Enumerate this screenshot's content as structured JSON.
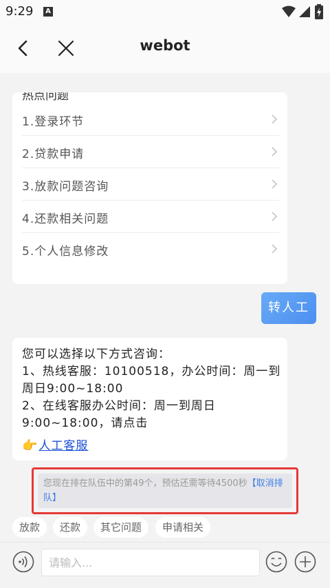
{
  "status": {
    "time": "9:29",
    "notification_letter": "A"
  },
  "header": {
    "title": "webot"
  },
  "hot_questions": {
    "title": "热点问题",
    "items": [
      {
        "label": "1.登录环节"
      },
      {
        "label": "2.贷款申请"
      },
      {
        "label": "3.放款问题咨询"
      },
      {
        "label": "4.还款相关问题"
      },
      {
        "label": "5.个人信息修改"
      }
    ]
  },
  "user_message": {
    "text": "转人工"
  },
  "bot_message": {
    "line1": "您可以选择以下方式咨询：",
    "line2": "1、热线客服：10100518，办公时间：周一到周日9:00~18:00",
    "line3": "2、在线客服办公时间：周一到周日9:00~18:00，请点击",
    "link_text": "人工客服"
  },
  "queue": {
    "text": "您现在排在队伍中的第49个，预估还需等待4500秒",
    "cancel_text": "【取消排队】"
  },
  "quick_tags": [
    {
      "label": "放款"
    },
    {
      "label": "还款"
    },
    {
      "label": "其它问题"
    },
    {
      "label": "申请相关"
    }
  ],
  "input": {
    "placeholder": "请输入..."
  },
  "colors": {
    "accent": "#4d8ff0",
    "link": "#1a4fd6",
    "highlight_border": "#e53935"
  }
}
